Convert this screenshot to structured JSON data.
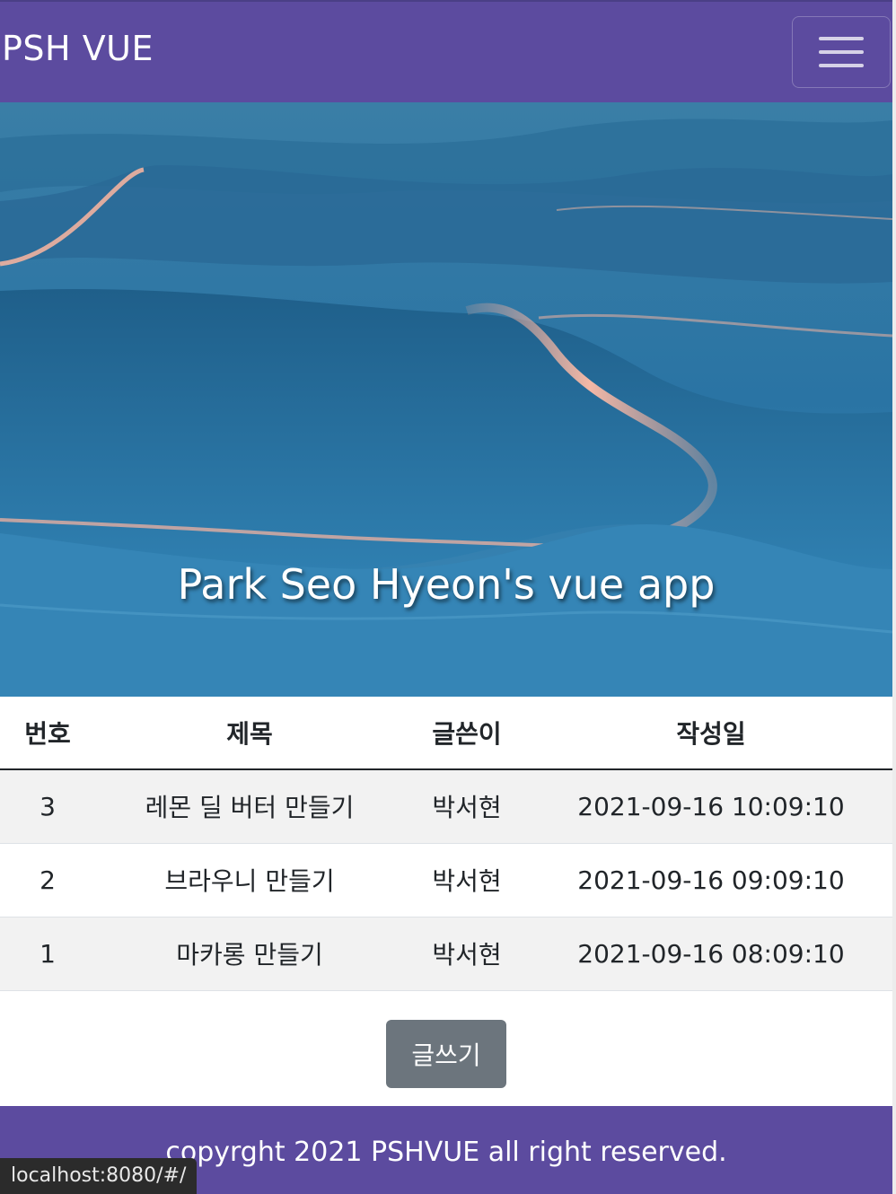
{
  "navbar": {
    "brand": "PSH VUE",
    "toggler_icon": "hamburger-menu-icon",
    "color": "#5c4b9f"
  },
  "hero": {
    "title": "Park Seo Hyeon's vue app"
  },
  "board": {
    "headers": [
      "번호",
      "제목",
      "글쓴이",
      "작성일"
    ],
    "rows": [
      {
        "no": "3",
        "title": "레몬 딜 버터 만들기",
        "writer": "박서현",
        "date": "2021-09-16 10:09:10"
      },
      {
        "no": "2",
        "title": "브라우니 만들기",
        "writer": "박서현",
        "date": "2021-09-16 09:09:10"
      },
      {
        "no": "1",
        "title": "마카롱 만들기",
        "writer": "박서현",
        "date": "2021-09-16 08:09:10"
      }
    ]
  },
  "actions": {
    "write_label": "글쓰기"
  },
  "footer": {
    "text": "copyrght 2021 PSHVUE all right reserved."
  },
  "status_bar": {
    "url": "localhost:8080/#/"
  }
}
